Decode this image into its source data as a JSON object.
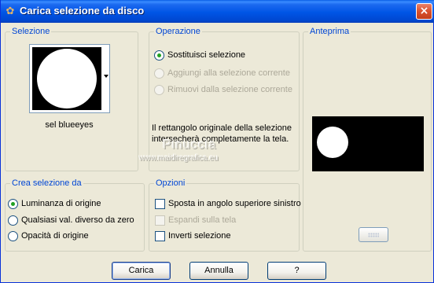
{
  "window": {
    "title": "Carica selezione da disco",
    "close_label": "×"
  },
  "selection_group": {
    "label": "Selezione",
    "selected_name": "sel blueeyes"
  },
  "operation_group": {
    "label": "Operazione",
    "options": [
      {
        "label": "Sostituisci selezione",
        "checked": true,
        "enabled": true
      },
      {
        "label": "Aggiungi alla selezione corrente",
        "checked": false,
        "enabled": false
      },
      {
        "label": "Rimuovi dalla selezione corrente",
        "checked": false,
        "enabled": false
      }
    ],
    "info_text": "Il rettangolo originale della selezione intersecherà completamente la tela."
  },
  "preview_group": {
    "label": "Anteprima"
  },
  "create_group": {
    "label": "Crea selezione da",
    "options": [
      {
        "label": "Luminanza di origine",
        "checked": true
      },
      {
        "label": "Qualsiasi val. diverso da zero",
        "checked": false
      },
      {
        "label": "Opacità di origine",
        "checked": false
      }
    ]
  },
  "options_group": {
    "label": "Opzioni",
    "options": [
      {
        "label": "Sposta in angolo superiore sinistro",
        "checked": false,
        "enabled": true
      },
      {
        "label": "Espandi sulla tela",
        "checked": false,
        "enabled": false
      },
      {
        "label": "Inverti selezione",
        "checked": false,
        "enabled": true
      }
    ]
  },
  "watermark": {
    "name": "Pinuccia",
    "url": "www.maidiregrafica.eu"
  },
  "buttons": {
    "load": "Carica",
    "cancel": "Annulla",
    "help": "?"
  },
  "colors": {
    "accent": "#0046D5",
    "titlebar": "#0055E5",
    "radio_check": "#21A121"
  }
}
